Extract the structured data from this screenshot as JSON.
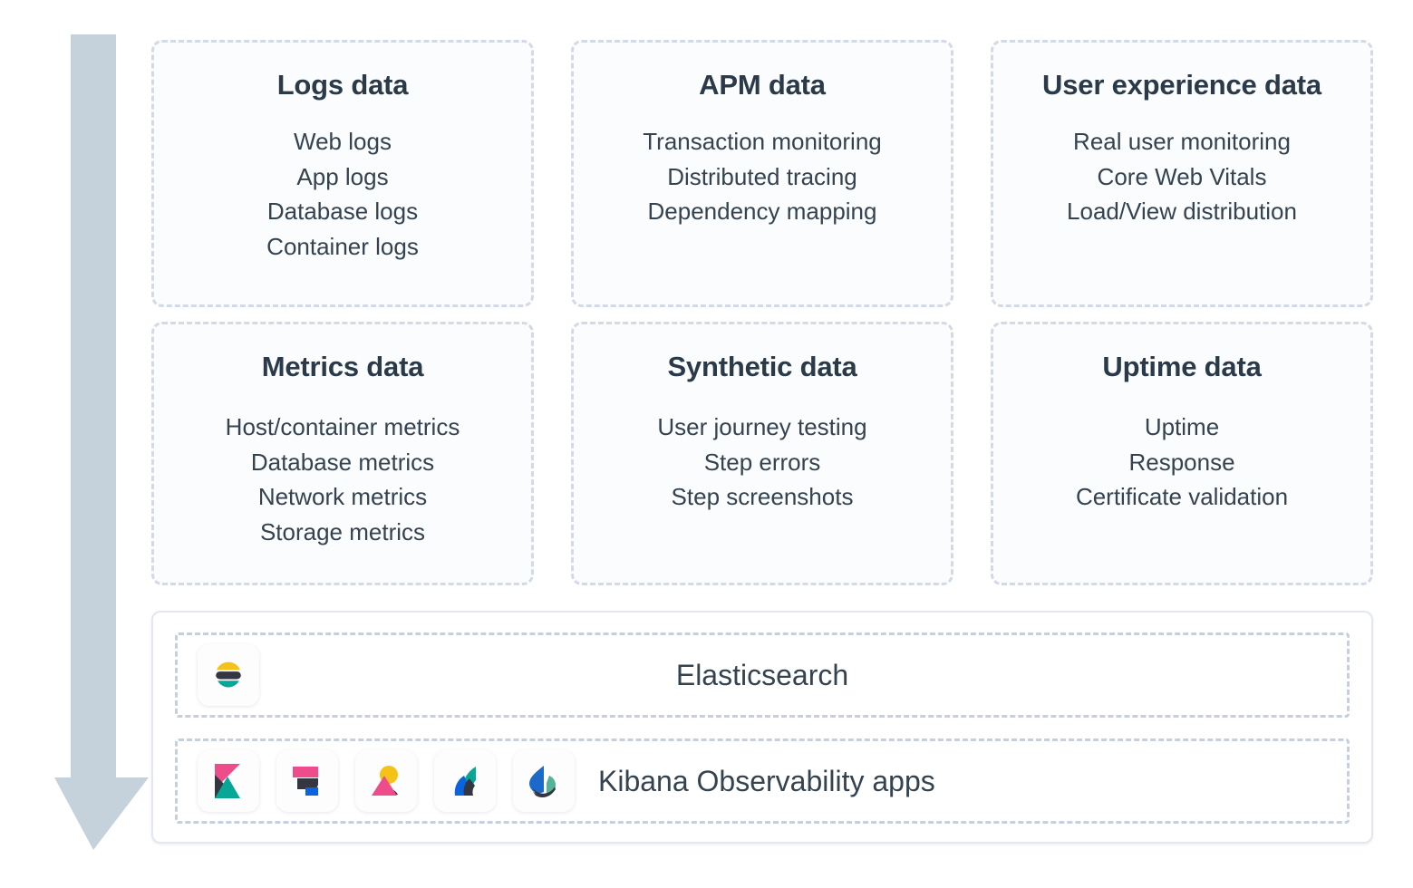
{
  "diagram": {
    "arrow": {
      "name": "downward-flow-arrow",
      "color": "#c5d2dc"
    },
    "cards": [
      {
        "id": "logs-data",
        "title": "Logs data",
        "items": [
          "Web logs",
          "App logs",
          "Database logs",
          "Container logs"
        ]
      },
      {
        "id": "apm-data",
        "title": "APM data",
        "items": [
          "Transaction monitoring",
          "Distributed tracing",
          "Dependency mapping"
        ]
      },
      {
        "id": "user-experience-data",
        "title": "User experience data",
        "items": [
          "Real user monitoring",
          "Core Web Vitals",
          "Load/View distribution"
        ]
      },
      {
        "id": "metrics-data",
        "title": "Metrics data",
        "items": [
          "Host/container metrics",
          "Database metrics",
          "Network metrics",
          "Storage metrics"
        ]
      },
      {
        "id": "synthetic-data",
        "title": "Synthetic data",
        "items": [
          "User journey testing",
          "Step errors",
          "Step screenshots"
        ]
      },
      {
        "id": "uptime-data",
        "title": "Uptime data",
        "items": [
          "Uptime",
          "Response",
          "Certificate validation"
        ]
      }
    ],
    "platform": {
      "elasticsearch": {
        "label": "Elasticsearch",
        "icon": "elasticsearch-logo-icon"
      },
      "kibana": {
        "label": "Kibana Observability apps",
        "icons": [
          "kibana-logo-icon",
          "logs-app-icon",
          "metrics-app-icon",
          "uptime-app-icon",
          "observability-app-icon"
        ]
      }
    },
    "colors": {
      "text": "#34434f",
      "title": "#2b3a49",
      "card_border": "#d3dae6",
      "card_fill": "#fbfcfd",
      "platform_border": "#e3e8ef",
      "inner_dash": "#c6d0dd",
      "arrow": "#c5d2dc",
      "elastic_yellow": "#f5c219",
      "elastic_teal": "#07a798",
      "elastic_dark": "#343741",
      "elastic_pink": "#ee4c8b",
      "elastic_blue": "#0b64dd"
    }
  }
}
